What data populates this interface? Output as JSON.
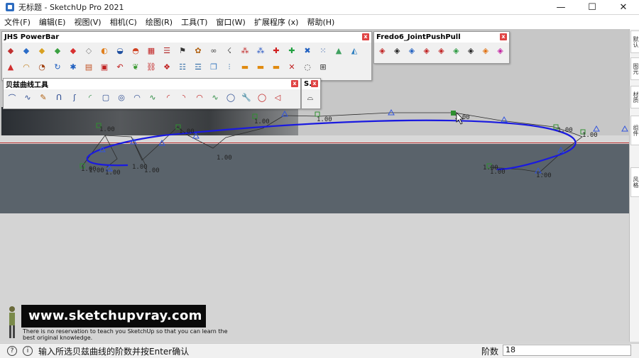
{
  "window": {
    "title": "无标题 - SketchUp Pro 2021",
    "minimize_glyph": "—",
    "maximize_glyph": "☐",
    "close_glyph": "✕"
  },
  "menu": [
    "文件(F)",
    "编辑(E)",
    "视图(V)",
    "相机(C)",
    "绘图(R)",
    "工具(T)",
    "窗口(W)",
    "扩展程序 (x)",
    "帮助(H)"
  ],
  "toolbars": {
    "jhs": {
      "title": "JHS PowerBar",
      "close": "x"
    },
    "fredo": {
      "title": "Fredo6_JointPushPull",
      "close": "x"
    },
    "bezier": {
      "title": "贝兹曲线工具",
      "close": "x"
    },
    "small": {
      "title": "S..",
      "close": "x"
    }
  },
  "right_panel_tabs": [
    "默认",
    "图元",
    "材质",
    "组件",
    "风格"
  ],
  "scene": {
    "segment_labels": [
      "1.00",
      "1.00",
      "1.00",
      "1.00",
      "1.00",
      "1.00",
      "1.00",
      "1.00",
      "1.00",
      "1.00",
      "1.00",
      "1.00",
      "1.00",
      "1.00",
      "1.00",
      "1.00"
    ],
    "curve_color": "#1a1ae0",
    "control_color": "#2f8f2f"
  },
  "watermark": {
    "url": "www.sketchupvray.com",
    "tagline": "There is no reservation to teach you SketchUp so that you can learn the best original knowledge."
  },
  "status": {
    "text": "输入所选贝兹曲线的阶数并按Enter确认",
    "vcb_label": "阶数",
    "vcb_value": "18"
  },
  "icons": [
    "sketchup-app-icon",
    "info-icon",
    "help-icon",
    "cursor-arrow-icon"
  ]
}
